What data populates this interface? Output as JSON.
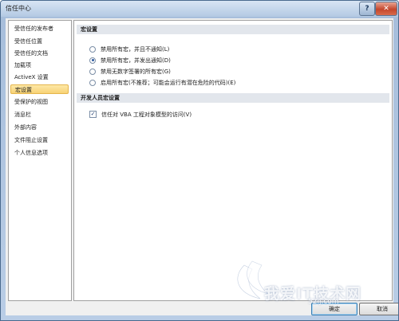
{
  "window": {
    "title": "信任中心",
    "help_label": "?",
    "close_label": "✕"
  },
  "nav": {
    "items": [
      {
        "label": "受信任的发布者"
      },
      {
        "label": "受信任位置"
      },
      {
        "label": "受信任的文档"
      },
      {
        "label": "加载项"
      },
      {
        "label": "ActiveX 设置"
      },
      {
        "label": "宏设置"
      },
      {
        "label": "受保护的视图"
      },
      {
        "label": "消息栏"
      },
      {
        "label": "外部内容"
      },
      {
        "label": "文件阻止设置"
      },
      {
        "label": "个人信息选项"
      }
    ],
    "selected": "宏设置"
  },
  "macro": {
    "header": "宏设置",
    "options": [
      {
        "label": "禁用所有宏，并且不通知(L)",
        "checked": false
      },
      {
        "label": "禁用所有宏，并发出通知(D)",
        "checked": true
      },
      {
        "label": "禁用无数字签署的所有宏(G)",
        "checked": false
      },
      {
        "label": "启用所有宏(不推荐；可能会运行有潜在危险的代码)(E)",
        "checked": false
      }
    ]
  },
  "developer": {
    "header": "开发人员宏设置",
    "vba_label": "信任对 VBA 工程对象模型的访问(V)",
    "vba_checked": true
  },
  "buttons": {
    "ok": "确定",
    "cancel": "取消"
  },
  "watermark": {
    "text": "我爱IT技术网",
    "sub": "52ij.com"
  }
}
